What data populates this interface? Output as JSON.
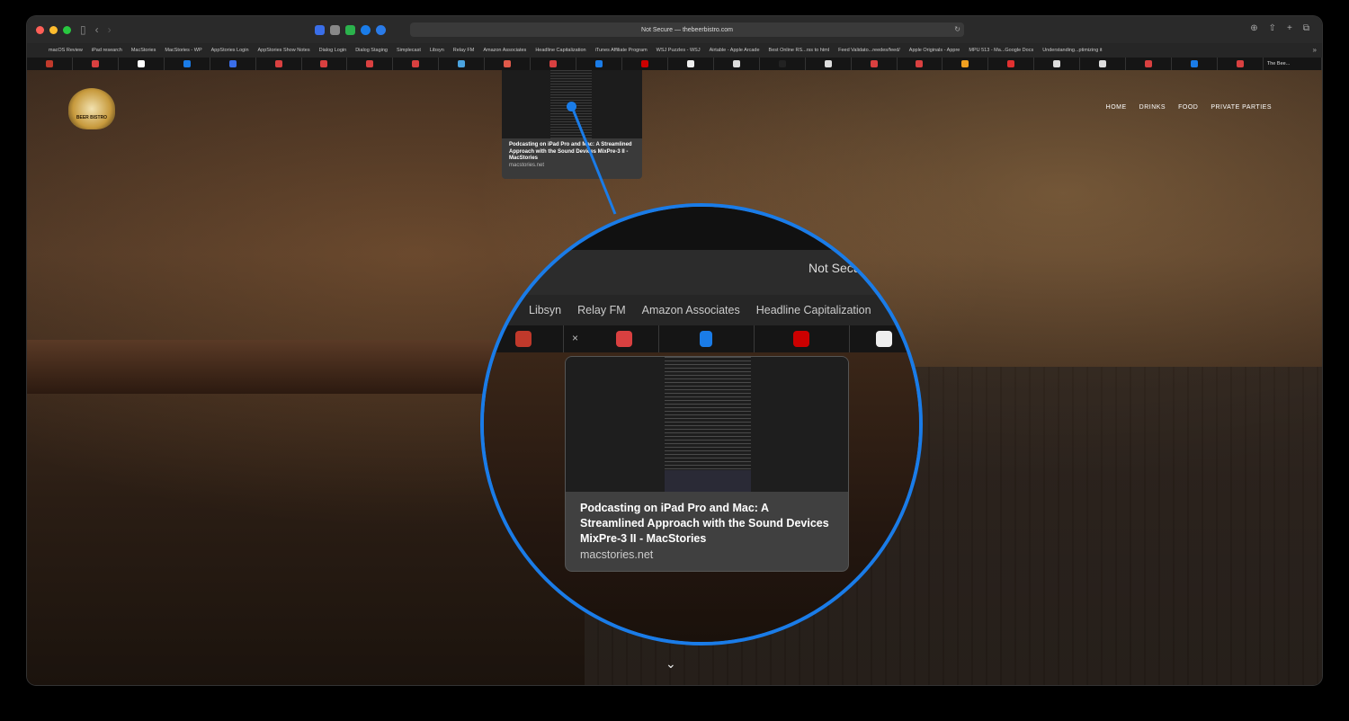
{
  "toolbar": {
    "address": "Not Secure — thebeerbistro.com",
    "back_icon": "chevron-left-icon",
    "forward_icon": "chevron-right-icon",
    "sidebar_icon": "sidebar-icon"
  },
  "bookmarks": [
    "macOS Review",
    "iPad research",
    "MacStories",
    "MacStories - WP",
    "AppStories Login",
    "AppStories Show Notes",
    "Dialog Login",
    "Dialog Staging",
    "Simplecast",
    "Libsyn",
    "Relay FM",
    "Amazon Associates",
    "Headline Capitalization",
    "iTunes Affiliate Program",
    "WSJ Puzzles - WSJ",
    "Airtable - Apple Arcade",
    "Best Online RS...rss to html",
    "Feed Validato...reedes/feed/",
    "Apple Originals - Appre",
    "MPU 513 - Ma...Google Docs",
    "Understanding...ptimizing it"
  ],
  "tabs": {
    "count": 27,
    "active_title": "The Bee...",
    "favicon_colors": [
      "#c0392b",
      "#d94040",
      "#ffffff",
      "#1a7ce8",
      "#3a6ee8",
      "#d94040",
      "#d94040",
      "#d94040",
      "#d94040",
      "#4aa3df",
      "#e05a4a",
      "#d94040",
      "#1a7ce8",
      "#cc0000",
      "#eeeeee",
      "#dddddd",
      "#222222",
      "#dddddd",
      "#d94040",
      "#d94040",
      "#f0a020",
      "#e03030",
      "#dddddd",
      "#dddddd",
      "#d94040",
      "#1a7ce8",
      "#d94040"
    ]
  },
  "site": {
    "logo_text": "BEER BISTRO",
    "nav": [
      "HOME",
      "DRINKS",
      "FOOD",
      "PRIVATE PARTIES"
    ],
    "scroll_icon": "chevron-down-icon"
  },
  "preview": {
    "title": "Podcasting on iPad Pro and Mac: A Streamlined Approach with the Sound Devices MixPre-3 II - MacStories",
    "domain": "macstories.net"
  },
  "magnifier": {
    "address_fragment": "Not Secu",
    "bookmarks": [
      "Libsyn",
      "Relay FM",
      "Amazon Associates",
      "Headline Capitalization"
    ],
    "close_glyph": "×",
    "title": "Podcasting on iPad Pro and Mac: A Streamlined Approach with the Sound Devices MixPre-3 II - MacStories",
    "domain": "macstories.net"
  },
  "colors": {
    "accent": "#1a7ce8",
    "traffic_red": "#ff5f57",
    "traffic_yellow": "#febc2e",
    "traffic_green": "#28c840"
  }
}
